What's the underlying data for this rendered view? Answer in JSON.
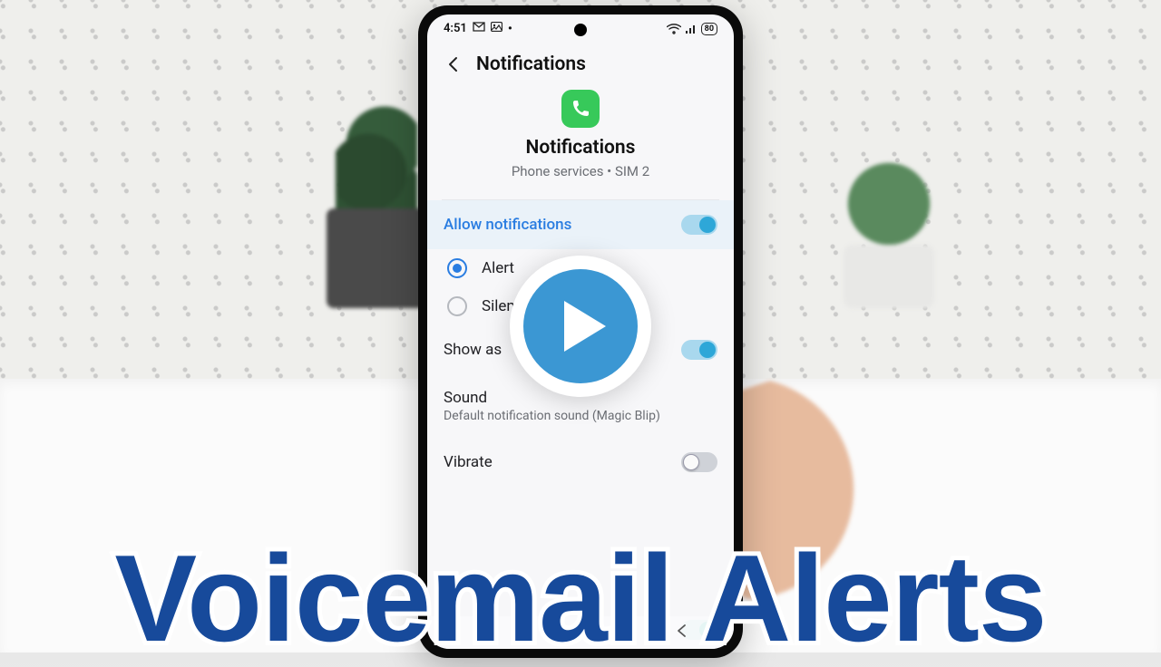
{
  "status_bar": {
    "time": "4:51",
    "battery": "80"
  },
  "header": {
    "title": "Notifications"
  },
  "app": {
    "title": "Notifications",
    "subtitle": "Phone services • SIM 2"
  },
  "rows": {
    "allow": {
      "label": "Allow notifications"
    },
    "alert_option": {
      "label": "Alert"
    },
    "silent_option": {
      "label": "Silent"
    },
    "show_as": {
      "label": "Show as"
    },
    "sound": {
      "label": "Sound",
      "value": "Default notification sound (Magic Blip)"
    },
    "vibrate": {
      "label": "Vibrate"
    }
  },
  "thumbnail": {
    "caption": "Voicemail Alerts"
  }
}
